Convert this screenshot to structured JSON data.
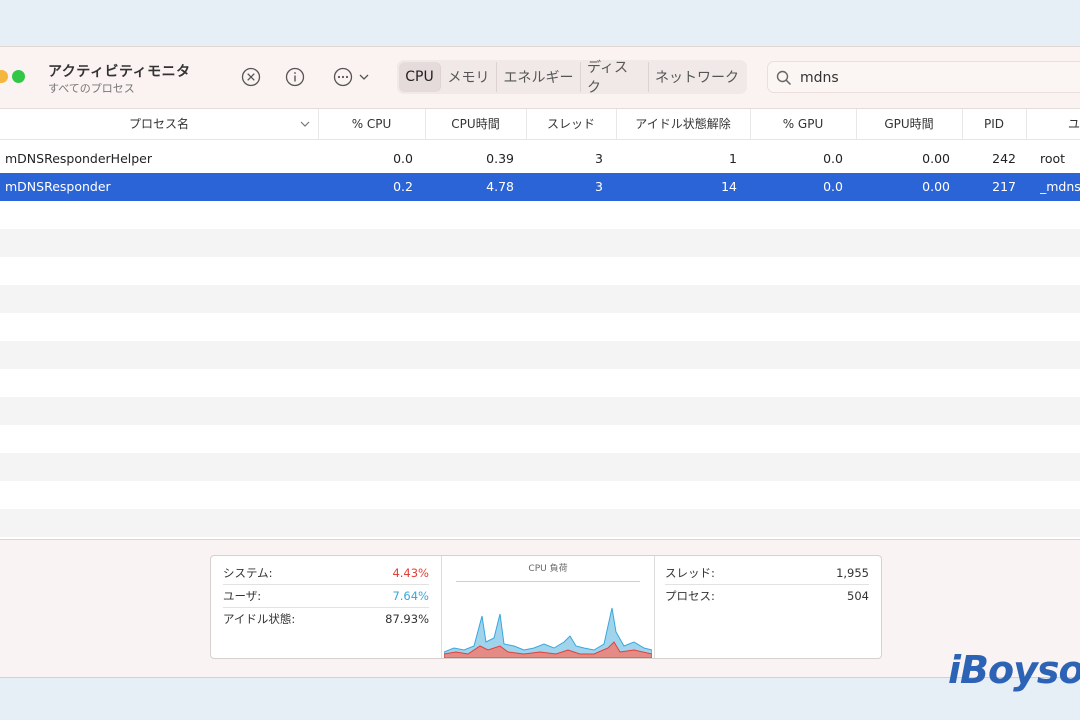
{
  "app": {
    "title": "アクティビティモニタ",
    "subtitle": "すべてのプロセス"
  },
  "toolbar": {
    "tabs": [
      {
        "label": "CPU"
      },
      {
        "label": "メモリ"
      },
      {
        "label": "エネルギー"
      },
      {
        "label": "ディスク"
      },
      {
        "label": "ネットワーク"
      }
    ],
    "search_value": "mdns"
  },
  "table": {
    "columns": [
      "プロセス名",
      "% CPU",
      "CPU時間",
      "スレッド",
      "アイドル状態解除",
      "% GPU",
      "GPU時間",
      "PID",
      "ユ"
    ],
    "rows": [
      {
        "name": "mDNSResponderHelper",
        "cpu": "0.0",
        "cpu_time": "0.39",
        "threads": "3",
        "idle_wakeups": "1",
        "gpu": "0.0",
        "gpu_time": "0.00",
        "pid": "242",
        "user": "root"
      },
      {
        "name": "mDNSResponder",
        "cpu": "0.2",
        "cpu_time": "4.78",
        "threads": "3",
        "idle_wakeups": "14",
        "gpu": "0.0",
        "gpu_time": "0.00",
        "pid": "217",
        "user": "_mdns"
      }
    ]
  },
  "summary": {
    "system_label": "システム:",
    "system_value": "4.43%",
    "user_label": "ユーザ:",
    "user_value": "7.64%",
    "idle_label": "アイドル状態:",
    "idle_value": "87.93%",
    "chart_title": "CPU 負荷",
    "threads_label": "スレッド:",
    "threads_value": "1,955",
    "processes_label": "プロセス:",
    "processes_value": "504"
  },
  "colors": {
    "system": "#e0403a",
    "user": "#3aa6dd",
    "selected_row": "#2b64d7"
  },
  "watermark": "iBoysoft"
}
